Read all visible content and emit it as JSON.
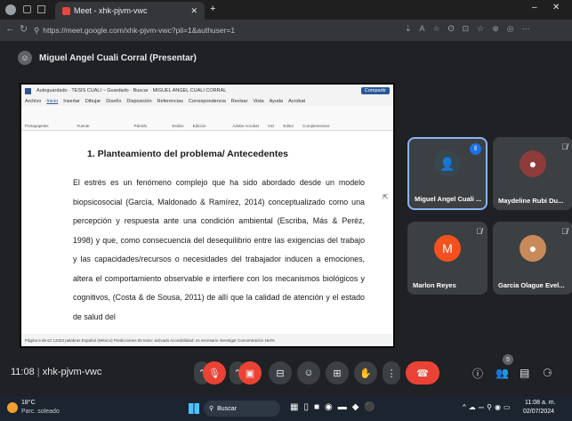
{
  "browser": {
    "tab_title": "Meet - xhk-pjvm-vwc",
    "url": "https://meet.google.com/xhk-pjvm-vwc?pli=1&authuser=1"
  },
  "presenter": {
    "label": "Miguel Angel Cuali Corral (Presentar)"
  },
  "word": {
    "title_bar": "Autoguardado  ·  TESIS CUALI ~ Guardado  ·  Buscar  ·  MIGUEL ANGEL CUALI CORRAL",
    "menu": [
      "Archivo",
      "Inicio",
      "Insertar",
      "Dibujar",
      "Diseño",
      "Disposición",
      "Referencias",
      "Correspondencia",
      "Revisar",
      "Vista",
      "Ayuda",
      "Acrobat"
    ],
    "ribbon_groups": [
      "Portapapeles",
      "Fuente",
      "Párrafo",
      "Estilos",
      "Edición",
      "Adobe Acrobat",
      "Voz",
      "Editor",
      "Complementos"
    ],
    "status_bar": "Página 6 de 61   13423 palabras   Español (México)   Predicciones de texto: activado   Accesibilidad: es necesario investigar   Concentración   164%",
    "heading": "1.  Planteamiento del problema/ Antecedentes",
    "paragraph": "El estrés es un fenómeno complejo que ha sido abordado desde un modelo biopsicosocial (García, Maldonado & Ramírez, 2014) conceptualizado como una percepción y respuesta ante una condición ambiental (Escriba, Más & Peréz, 1998) y que, como consecuencia del desequilibrio entre las exigencias del trabajo y las capacidades/recursos o necesidades del trabajador inducen a emociones, altera el comportamiento observable e interfiere con los mecanismos biológicos y cognitivos, (Costa & de Sousa, 2011) de allí que la calidad de atención y el estado de salud del"
  },
  "participants": [
    {
      "name": "Miguel Angel Cuali ...",
      "avatar_color": "#37474f",
      "initial": ""
    },
    {
      "name": "Maydeline Rubi Du...",
      "avatar_color": "#8e3b3b",
      "initial": ""
    },
    {
      "name": "Marlon Reyes",
      "avatar_color": "#f4511e",
      "initial": "M"
    },
    {
      "name": "Garcia Olague Evel...",
      "avatar_color": "#c98a5a",
      "initial": ""
    }
  ],
  "meeting": {
    "time": "11:08",
    "code": "xhk-pjvm-vwc",
    "participant_count": "5"
  },
  "taskbar": {
    "weather_temp": "18°C",
    "weather_desc": "Parc. soleado",
    "search": "Buscar",
    "clock_time": "11:08 a. m.",
    "clock_date": "02/07/2024"
  },
  "colors": {
    "accent": "#8ab4f8",
    "end_call": "#ea4335",
    "word_blue": "#2b579a"
  }
}
